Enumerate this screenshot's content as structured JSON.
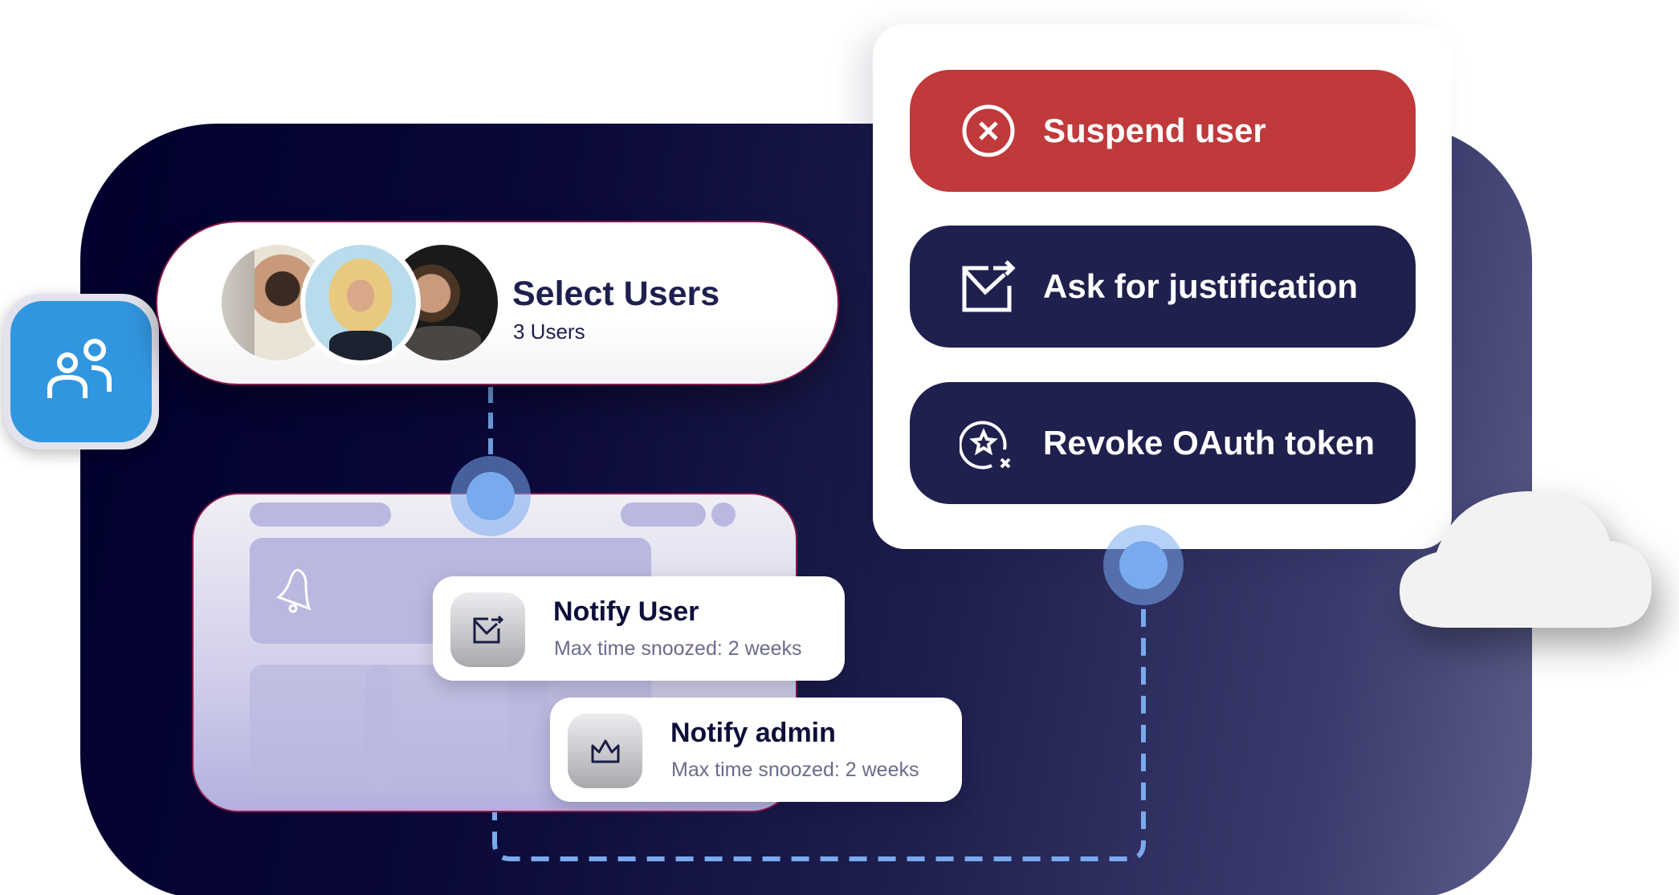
{
  "colors": {
    "panel_dark": "#01002d",
    "panel_light": "#5c5e8a",
    "accent_blue": "#3196e0",
    "connector_blue": "#7aaaee",
    "danger_red": "#c0393b",
    "navy": "#20204f",
    "dashboard_block": "#b9b8e0"
  },
  "users_icon": {
    "icon": "users-icon"
  },
  "select_users": {
    "title": "Select Users",
    "subtitle": "3 Users",
    "avatars": [
      "avatar-user-1",
      "avatar-user-2",
      "avatar-user-3"
    ]
  },
  "dashboard": {
    "icon": "bell-icon"
  },
  "notifications": [
    {
      "title": "Notify User",
      "subtitle": "Max time snoozed: 2 weeks",
      "icon": "mail-forward-icon"
    },
    {
      "title": "Notify admin",
      "subtitle": "Max time snoozed: 2 weeks",
      "icon": "crown-icon"
    }
  ],
  "actions": [
    {
      "label": "Suspend user",
      "icon": "circle-x-icon",
      "style": "danger"
    },
    {
      "label": "Ask for justification",
      "icon": "mail-forward-icon",
      "style": "navy"
    },
    {
      "label": "Revoke OAuth token",
      "icon": "star-revoke-icon",
      "style": "navy"
    }
  ],
  "decor": {
    "cloud": "cloud-icon"
  }
}
